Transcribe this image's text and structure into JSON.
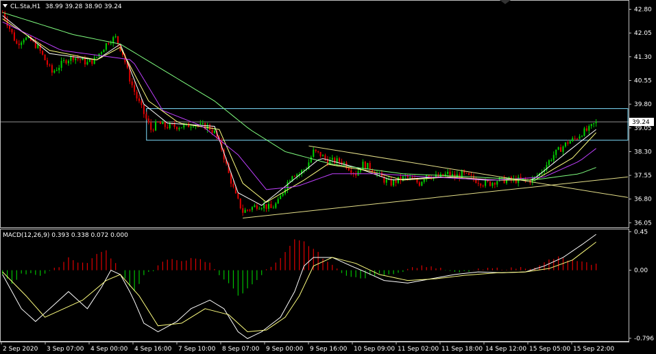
{
  "header": {
    "symbol_label": "CL.Sta,H1",
    "ohlc_label": "38.99 39.28 38.90 39.24"
  },
  "macd_header": {
    "label": "MACD(12,26,9) 0.393 0.338 0.072 0.000"
  },
  "colors": {
    "background": "#000000",
    "frame": "#c0c0c0",
    "bull_candle": "#00d000",
    "bear_candle": "#e00000",
    "ma_fast": "#ffffff",
    "ma_mid": "#ffff80",
    "ma_slow": "#c040ff",
    "ma_long": "#80ff80",
    "trendline": "#e6e08a",
    "box": "#80e0ff",
    "macd_main": "#ffffff",
    "macd_signal": "#ffff80",
    "hist_pos": "#e00000",
    "hist_neg": "#00c000"
  },
  "chart_data": [
    {
      "type": "candlestick",
      "price_axis_ticks": [
        "42.80",
        "42.05",
        "41.30",
        "40.55",
        "39.80",
        "39.05",
        "38.30",
        "37.55",
        "36.80",
        "36.05"
      ],
      "current_price_label": "39.24",
      "time_axis_ticks": [
        "2 Sep 2020",
        "3 Sep 07:00",
        "4 Sep 00:00",
        "4 Sep 16:00",
        "7 Sep 10:00",
        "8 Sep 07:00",
        "9 Sep 00:00",
        "9 Sep 16:00",
        "10 Sep 09:00",
        "11 Sep 02:00",
        "11 Sep 18:00",
        "14 Sep 12:00",
        "15 Sep 05:00",
        "15 Sep 22:00"
      ],
      "ylim": [
        35.95,
        43.05
      ],
      "bars": 252,
      "close_path": [
        [
          0,
          42.7
        ],
        [
          3,
          42.2
        ],
        [
          6,
          41.7
        ],
        [
          9,
          41.9
        ],
        [
          12,
          41.8
        ],
        [
          15,
          41.6
        ],
        [
          18,
          41.2
        ],
        [
          21,
          40.8
        ],
        [
          24,
          41.0
        ],
        [
          27,
          41.2
        ],
        [
          30,
          41.3
        ],
        [
          33,
          41.2
        ],
        [
          36,
          41.1
        ],
        [
          39,
          41.2
        ],
        [
          42,
          41.5
        ],
        [
          45,
          41.8
        ],
        [
          48,
          41.9
        ],
        [
          51,
          41.4
        ],
        [
          54,
          40.6
        ],
        [
          57,
          40.0
        ],
        [
          60,
          39.5
        ],
        [
          63,
          39.0
        ],
        [
          66,
          39.2
        ],
        [
          69,
          39.1
        ],
        [
          72,
          39.1
        ],
        [
          75,
          39.1
        ],
        [
          78,
          39.1
        ],
        [
          81,
          39.2
        ],
        [
          84,
          39.1
        ],
        [
          87,
          39.1
        ],
        [
          90,
          38.9
        ],
        [
          93,
          38.4
        ],
        [
          96,
          37.6
        ],
        [
          99,
          36.9
        ],
        [
          102,
          36.4
        ],
        [
          105,
          36.5
        ],
        [
          108,
          36.6
        ],
        [
          111,
          36.6
        ],
        [
          114,
          36.5
        ],
        [
          117,
          36.7
        ],
        [
          120,
          37.2
        ],
        [
          123,
          37.6
        ],
        [
          126,
          37.6
        ],
        [
          129,
          37.8
        ],
        [
          132,
          38.3
        ],
        [
          135,
          38.2
        ],
        [
          138,
          38.0
        ],
        [
          141,
          38.0
        ],
        [
          144,
          38.0
        ],
        [
          147,
          37.8
        ],
        [
          150,
          37.6
        ],
        [
          153,
          37.9
        ],
        [
          156,
          37.8
        ],
        [
          159,
          37.6
        ],
        [
          162,
          37.4
        ],
        [
          165,
          37.3
        ],
        [
          168,
          37.4
        ],
        [
          171,
          37.5
        ],
        [
          174,
          37.4
        ],
        [
          177,
          37.3
        ],
        [
          180,
          37.6
        ],
        [
          183,
          37.5
        ],
        [
          186,
          37.5
        ],
        [
          189,
          37.6
        ],
        [
          192,
          37.5
        ],
        [
          195,
          37.6
        ],
        [
          198,
          37.5
        ],
        [
          201,
          37.4
        ],
        [
          204,
          37.3
        ],
        [
          207,
          37.3
        ],
        [
          210,
          37.4
        ],
        [
          213,
          37.4
        ],
        [
          216,
          37.4
        ],
        [
          219,
          37.4
        ],
        [
          222,
          37.4
        ],
        [
          225,
          37.4
        ],
        [
          228,
          37.6
        ],
        [
          231,
          37.9
        ],
        [
          234,
          38.2
        ],
        [
          237,
          38.4
        ],
        [
          240,
          38.6
        ],
        [
          243,
          38.7
        ],
        [
          246,
          38.9
        ],
        [
          249,
          39.0
        ],
        [
          252,
          39.24
        ]
      ],
      "moving_averages": [
        {
          "key": "ma_fast",
          "path": [
            [
              0,
              42.6
            ],
            [
              20,
              41.4
            ],
            [
              40,
              41.2
            ],
            [
              50,
              41.7
            ],
            [
              60,
              39.8
            ],
            [
              70,
              39.2
            ],
            [
              90,
              39.1
            ],
            [
              100,
              37.0
            ],
            [
              110,
              36.6
            ],
            [
              125,
              37.5
            ],
            [
              135,
              38.1
            ],
            [
              150,
              37.8
            ],
            [
              165,
              37.4
            ],
            [
              185,
              37.5
            ],
            [
              205,
              37.4
            ],
            [
              225,
              37.4
            ],
            [
              240,
              38.3
            ],
            [
              252,
              39.0
            ]
          ]
        },
        {
          "key": "ma_mid",
          "path": [
            [
              0,
              42.5
            ],
            [
              20,
              41.5
            ],
            [
              40,
              41.2
            ],
            [
              50,
              41.6
            ],
            [
              62,
              39.9
            ],
            [
              75,
              39.2
            ],
            [
              92,
              39.0
            ],
            [
              102,
              37.3
            ],
            [
              112,
              36.7
            ],
            [
              128,
              37.4
            ],
            [
              138,
              37.9
            ],
            [
              155,
              37.7
            ],
            [
              170,
              37.4
            ],
            [
              190,
              37.5
            ],
            [
              210,
              37.4
            ],
            [
              226,
              37.4
            ],
            [
              242,
              38.1
            ],
            [
              252,
              38.9
            ]
          ]
        },
        {
          "key": "ma_slow",
          "path": [
            [
              0,
              42.4
            ],
            [
              25,
              41.5
            ],
            [
              45,
              41.3
            ],
            [
              55,
              41.2
            ],
            [
              68,
              39.6
            ],
            [
              85,
              39.1
            ],
            [
              100,
              38.2
            ],
            [
              112,
              37.1
            ],
            [
              125,
              37.2
            ],
            [
              140,
              37.6
            ],
            [
              160,
              37.6
            ],
            [
              180,
              37.5
            ],
            [
              210,
              37.4
            ],
            [
              230,
              37.5
            ],
            [
              245,
              38.0
            ],
            [
              252,
              38.4
            ]
          ]
        },
        {
          "key": "ma_long",
          "path": [
            [
              0,
              42.7
            ],
            [
              30,
              42.0
            ],
            [
              50,
              41.7
            ],
            [
              70,
              40.8
            ],
            [
              90,
              39.9
            ],
            [
              105,
              39.0
            ],
            [
              120,
              38.3
            ],
            [
              140,
              37.9
            ],
            [
              170,
              37.6
            ],
            [
              200,
              37.5
            ],
            [
              225,
              37.4
            ],
            [
              245,
              37.6
            ],
            [
              252,
              37.8
            ]
          ]
        }
      ],
      "trendlines": [
        {
          "name": "upper-trendline",
          "from": [
            130,
            38.48
          ],
          "to": [
            266,
            36.85
          ]
        },
        {
          "name": "lower-trendline",
          "from": [
            102,
            36.2
          ],
          "to": [
            266,
            37.5
          ]
        }
      ],
      "zone": {
        "price_top": 39.66,
        "price_bottom": 38.66,
        "from_bar": 62
      },
      "horizontal_line": 39.24
    },
    {
      "type": "macd",
      "ticks": [
        "0.45",
        "0.00",
        "-0.796"
      ],
      "ylim": [
        -0.82,
        0.47
      ],
      "main_path": [
        [
          0,
          -0.05
        ],
        [
          8,
          -0.45
        ],
        [
          14,
          -0.6
        ],
        [
          22,
          -0.4
        ],
        [
          28,
          -0.25
        ],
        [
          36,
          -0.45
        ],
        [
          42,
          -0.2
        ],
        [
          46,
          0.0
        ],
        [
          50,
          -0.05
        ],
        [
          55,
          -0.3
        ],
        [
          60,
          -0.62
        ],
        [
          66,
          -0.72
        ],
        [
          74,
          -0.6
        ],
        [
          80,
          -0.45
        ],
        [
          88,
          -0.35
        ],
        [
          94,
          -0.45
        ],
        [
          100,
          -0.72
        ],
        [
          104,
          -0.8
        ],
        [
          110,
          -0.72
        ],
        [
          118,
          -0.55
        ],
        [
          124,
          -0.25
        ],
        [
          128,
          0.05
        ],
        [
          132,
          0.15
        ],
        [
          140,
          0.15
        ],
        [
          148,
          0.05
        ],
        [
          154,
          -0.02
        ],
        [
          162,
          -0.12
        ],
        [
          172,
          -0.15
        ],
        [
          182,
          -0.1
        ],
        [
          192,
          -0.05
        ],
        [
          202,
          -0.02
        ],
        [
          212,
          -0.03
        ],
        [
          222,
          -0.02
        ],
        [
          230,
          0.05
        ],
        [
          238,
          0.15
        ],
        [
          246,
          0.3
        ],
        [
          252,
          0.42
        ]
      ],
      "signal_path": [
        [
          0,
          -0.02
        ],
        [
          10,
          -0.3
        ],
        [
          18,
          -0.55
        ],
        [
          26,
          -0.45
        ],
        [
          34,
          -0.35
        ],
        [
          44,
          -0.12
        ],
        [
          50,
          -0.05
        ],
        [
          58,
          -0.3
        ],
        [
          66,
          -0.65
        ],
        [
          76,
          -0.62
        ],
        [
          86,
          -0.45
        ],
        [
          96,
          -0.52
        ],
        [
          104,
          -0.72
        ],
        [
          112,
          -0.7
        ],
        [
          120,
          -0.55
        ],
        [
          126,
          -0.3
        ],
        [
          132,
          0.05
        ],
        [
          140,
          0.15
        ],
        [
          150,
          0.08
        ],
        [
          160,
          -0.05
        ],
        [
          172,
          -0.12
        ],
        [
          184,
          -0.1
        ],
        [
          196,
          -0.06
        ],
        [
          210,
          -0.03
        ],
        [
          222,
          -0.02
        ],
        [
          232,
          0.02
        ],
        [
          242,
          0.12
        ],
        [
          252,
          0.33
        ]
      ],
      "histogram": [
        [
          0,
          -0.05
        ],
        [
          4,
          -0.15
        ],
        [
          8,
          -0.05
        ],
        [
          12,
          -0.03
        ],
        [
          16,
          -0.06
        ],
        [
          20,
          -0.02
        ],
        [
          24,
          0.05
        ],
        [
          28,
          0.15
        ],
        [
          32,
          0.1
        ],
        [
          36,
          0.08
        ],
        [
          40,
          0.2
        ],
        [
          44,
          0.22
        ],
        [
          48,
          0.08
        ],
        [
          52,
          -0.1
        ],
        [
          56,
          -0.25
        ],
        [
          60,
          -0.05
        ],
        [
          64,
          0.0
        ],
        [
          68,
          0.1
        ],
        [
          72,
          0.12
        ],
        [
          76,
          0.12
        ],
        [
          80,
          0.13
        ],
        [
          84,
          0.12
        ],
        [
          88,
          0.08
        ],
        [
          92,
          -0.05
        ],
        [
          96,
          -0.15
        ],
        [
          100,
          -0.3
        ],
        [
          104,
          -0.22
        ],
        [
          108,
          -0.1
        ],
        [
          112,
          0.0
        ],
        [
          116,
          0.08
        ],
        [
          120,
          0.2
        ],
        [
          124,
          0.35
        ],
        [
          128,
          0.33
        ],
        [
          132,
          0.25
        ],
        [
          136,
          0.15
        ],
        [
          140,
          0.05
        ],
        [
          144,
          -0.02
        ],
        [
          148,
          -0.08
        ],
        [
          152,
          -0.1
        ],
        [
          156,
          -0.07
        ],
        [
          160,
          -0.05
        ],
        [
          164,
          -0.04
        ],
        [
          168,
          -0.03
        ],
        [
          172,
          0.02
        ],
        [
          176,
          0.04
        ],
        [
          180,
          0.05
        ],
        [
          184,
          0.03
        ],
        [
          188,
          0.0
        ],
        [
          192,
          -0.03
        ],
        [
          196,
          -0.02
        ],
        [
          200,
          0.0
        ],
        [
          204,
          0.01
        ],
        [
          208,
          0.02
        ],
        [
          212,
          0.02
        ],
        [
          216,
          0.02
        ],
        [
          220,
          0.03
        ],
        [
          224,
          0.03
        ],
        [
          228,
          0.05
        ],
        [
          232,
          0.12
        ],
        [
          236,
          0.15
        ],
        [
          240,
          0.12
        ],
        [
          244,
          0.1
        ],
        [
          248,
          0.08
        ],
        [
          252,
          0.07
        ]
      ]
    }
  ]
}
